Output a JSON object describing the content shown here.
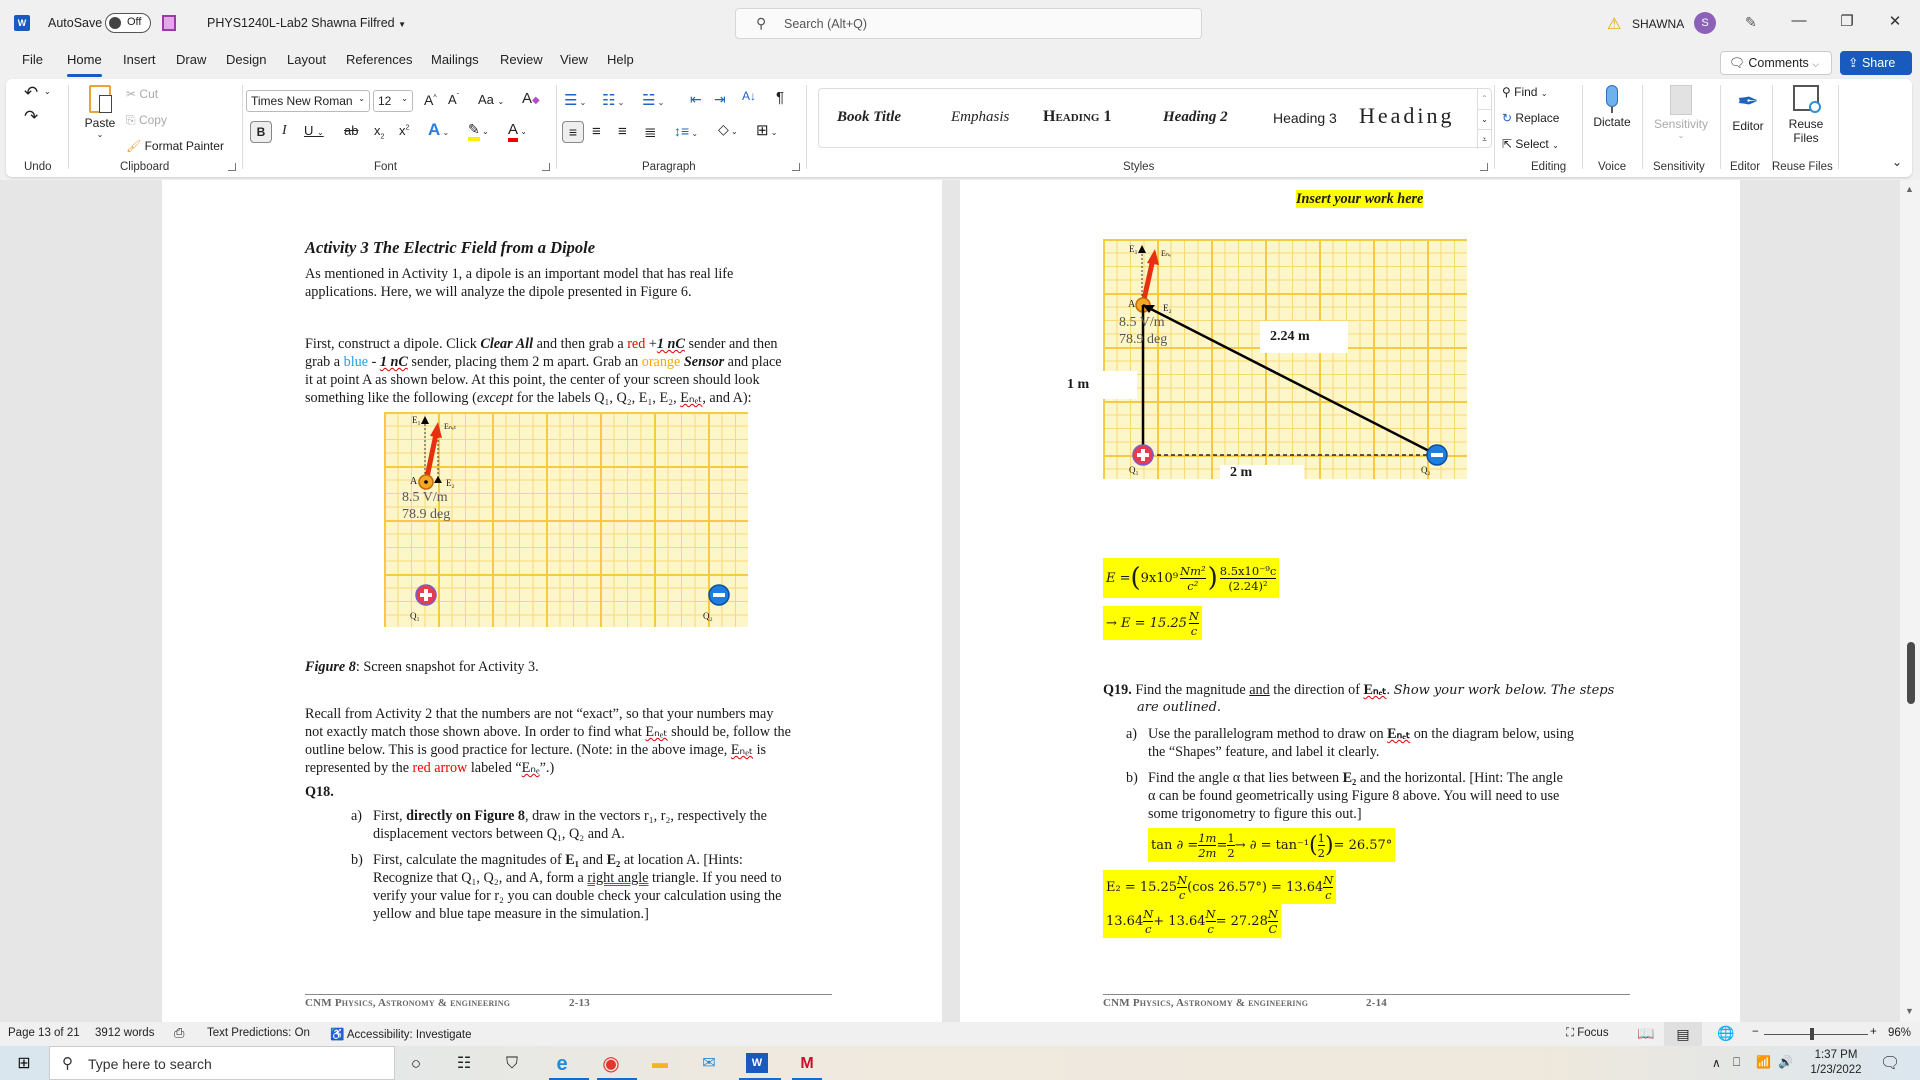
{
  "titlebar": {
    "app_icon": "word-icon",
    "autosave_label": "AutoSave",
    "autosave_state": "Off",
    "doc_title": "PHYS1240L-Lab2  Shawna Filfred",
    "search_placeholder": "Search (Alt+Q)",
    "user_name": "SHAWNA",
    "user_initial": "S",
    "window_buttons": [
      "—",
      "❐",
      "✕"
    ]
  },
  "menu": {
    "tabs": [
      "File",
      "Home",
      "Insert",
      "Draw",
      "Design",
      "Layout",
      "References",
      "Mailings",
      "Review",
      "View",
      "Help"
    ],
    "active_tab": "Home",
    "comments_label": "Comments",
    "share_label": "Share"
  },
  "ribbon": {
    "undo_group": "Undo",
    "clipboard": {
      "group": "Clipboard",
      "paste": "Paste",
      "cut": "Cut",
      "copy": "Copy",
      "format_painter": "Format Painter"
    },
    "font": {
      "group": "Font",
      "font_name": "Times New Roman",
      "font_size": "12",
      "change_case": "Aa"
    },
    "paragraph": {
      "group": "Paragraph"
    },
    "styles": {
      "group": "Styles",
      "items": [
        "Book Title",
        "Emphasis",
        "Heading 1",
        "Heading 2",
        "Heading 3",
        "Heading"
      ]
    },
    "editing": {
      "group": "Editing",
      "find": "Find",
      "replace": "Replace",
      "select": "Select"
    },
    "voice": {
      "group": "Voice",
      "dictate": "Dictate"
    },
    "sensitivity": {
      "group": "Sensitivity",
      "label": "Sensitivity"
    },
    "editor": {
      "group": "Editor",
      "label": "Editor"
    },
    "reuse": {
      "group": "Reuse Files",
      "label_line1": "Reuse",
      "label_line2": "Files"
    }
  },
  "page1": {
    "heading": "Activity 3 The Electric Field from a Dipole",
    "intro": [
      "As mentioned in Activity 1, a dipole is an important model that has real life",
      "applications. Here, we will analyze the dipole presented in Figure 6."
    ],
    "instr": {
      "l1_a": "First, construct a dipole. Click ",
      "l1_b": "Clear All",
      "l1_c": " and then grab a ",
      "l1_red": "red",
      "l1_d": " +",
      "l1_e": "1 nC",
      "l1_f": " sender and then",
      "l2_a": "grab a ",
      "l2_blue": "blue",
      "l2_b": " - ",
      "l2_c": "1 nC",
      "l2_d": " sender, placing them 2 m apart. Grab an ",
      "l2_orange": "orange",
      "l2_e": " ",
      "l2_f": "Sensor",
      "l2_g": " and place",
      "l3": "it at point A as shown below. At this point, the center of your screen should look",
      "l4_a": "something like the following (",
      "l4_b": "except",
      "l4_c": " for the labels Q₁, Q₂, E₁, E₂, ",
      "l4_d": "Eₙₑₜ",
      "l4_e": ", and A):"
    },
    "figure": {
      "point_label": "A",
      "e1": "E₁",
      "e2": "E₂",
      "enet": "Eₙₑₜ",
      "magnitude": "8.5 V/m",
      "angle": "78.9 deg",
      "q1": "Q₁",
      "q2": "Q₂"
    },
    "caption_bold": "Figure 8",
    "caption_rest": ": Screen snapshot for Activity 3.",
    "recall": {
      "l1": "Recall from Activity 2 that the numbers are not “exact”, so that your numbers may",
      "l2_a": "not exactly match those shown above. In order to find what ",
      "l2_b": "Eₙₑₜ",
      "l2_c": " should be, follow the",
      "l3_a": "outline below. This is good practice for lecture. (Note: in the above image, ",
      "l3_b": "Eₙₑₜ",
      "l3_c": " is",
      "l4_a": "represented by the ",
      "l4_red": "red arrow",
      "l4_b": " labeled “",
      "l4_c": "Eₙₑ",
      "l4_d": "”.)"
    },
    "q18": "Q18.",
    "q18a": {
      "marker": "a)",
      "l1_a": "First, ",
      "l1_b": "directly on Figure 8",
      "l1_c": ", draw in the vectors r₁, r₂, respectively the",
      "l2": "displacement vectors between Q₁, Q₂ and A."
    },
    "q18b": {
      "marker": "b)",
      "l1_a": "First, calculate the magnitudes of ",
      "l1_b": "E₁",
      "l1_c": " and ",
      "l1_d": "E₂",
      "l1_e": " at location A. [Hints:",
      "l2_a": "Recognize that Q₁, Q₂, and A, form a ",
      "l2_b": "right angle",
      "l2_c": " triangle. If you need to",
      "l3": "verify your value for r₂ you can double check your calculation using the",
      "l4": "yellow and blue tape measure in the simulation.]"
    },
    "footer_text": "CNM Physics, Astronomy & engineering",
    "footer_page": "2-13"
  },
  "page2": {
    "insert_work": "Insert your work here",
    "figure": {
      "point_label": "A",
      "e1": "E₁",
      "e2": "E₂",
      "enet": "Eₙₑ",
      "magnitude": "8.5 V/m",
      "angle": "78.9 deg",
      "q1": "Q₁",
      "q2": "Q₂",
      "hyp_label": "2.24 m",
      "vert_label": "1 m",
      "horiz_label": "2 m"
    },
    "eq1": "E = (9x10⁹ Nm²/c²) · 8.5x10⁻⁹c / (2.24)²",
    "eq1_parts": {
      "lhs": "E = ",
      "k": "9x10⁹",
      "kunit_num": "Nm²",
      "kunit_den": "c²",
      "q_num": "8.5x10⁻⁹c",
      "r_den": "(2.24)²"
    },
    "eq2_parts": {
      "lhs": "→ E = 15.25",
      "num": "N",
      "den": "c"
    },
    "q19": {
      "label": "Q19.",
      "l1_a": " Find the magnitude ",
      "l1_b": "and",
      "l1_c": " the direction of ",
      "l1_d": "Eₙₑₜ",
      "l1_e": ". ",
      "l1_f": "Show your work below. The steps",
      "l2": "are outlined."
    },
    "q19a": {
      "marker": "a)",
      "l1_a": "Use the parallelogram method to draw on ",
      "l1_b": "Eₙₑₜ",
      "l1_c": " on the diagram below, using",
      "l2": "the “Shapes” feature, and label it clearly."
    },
    "q19b": {
      "marker": "b)",
      "l1_a": "Find the angle α that lies between ",
      "l1_b": "E₂",
      "l1_c": " and the horizontal. [Hint: The angle",
      "l2": "α can be found geometrically using Figure 8 above. You will need to use",
      "l3": "some trigonometry to figure this out.]"
    },
    "eq3_parts": {
      "a": "tan ∂ = ",
      "f1n": "1m",
      "f1d": "2m",
      "b": " = ",
      "f2n": "1",
      "f2d": "2",
      "c": "  → ∂ = tan⁻¹",
      "f3n": "1",
      "f3d": "2",
      "d": " = 26.57°"
    },
    "eq4_parts": {
      "a": "E₂ =  15.25",
      "n": "N",
      "d": "c",
      "b": " (cos 26.57°) = 13.64 ",
      "n2": "N",
      "d2": "c"
    },
    "eq5_parts": {
      "a": "13.64 ",
      "n1": "N",
      "d1": "c",
      "b": " + 13.64 ",
      "n2": "N",
      "d2": "c",
      "c": " = 27.28",
      "n3": "N",
      "d3": "C"
    },
    "footer_text": "CNM Physics, Astronomy & engineering",
    "footer_page": "2-14"
  },
  "statusbar": {
    "page": "Page 13 of 21",
    "words": "3912 words",
    "text_predictions": "Text Predictions: On",
    "accessibility": "Accessibility: Investigate",
    "focus": "Focus",
    "zoom_minus": "−",
    "zoom_plus": "+",
    "zoom_level": "96%"
  },
  "taskbar": {
    "search_placeholder": "Type here to search",
    "time": "1:37 PM",
    "date": "1/23/2022"
  },
  "colors": {
    "accent": "#185abd",
    "highlight": "#ffff00",
    "grid_bg": "#fdf6c9",
    "grid_line": "#f7ca45",
    "enet_arrow": "#e8300f",
    "q_pos": "#e83b4f",
    "q_neg": "#1d7ee0"
  }
}
